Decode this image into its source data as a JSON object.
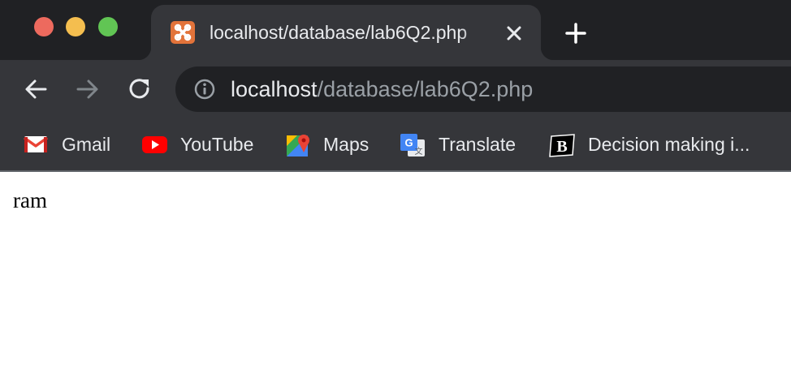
{
  "browser": {
    "tab": {
      "title": "localhost/database/lab6Q2.php",
      "favicon": "xampp-icon"
    },
    "address_bar": {
      "host": "localhost",
      "path": "/database/lab6Q2.php"
    },
    "bookmarks": [
      {
        "label": "Gmail",
        "icon": "gmail-icon"
      },
      {
        "label": "YouTube",
        "icon": "youtube-icon"
      },
      {
        "label": "Maps",
        "icon": "maps-icon"
      },
      {
        "label": "Translate",
        "icon": "translate-icon"
      },
      {
        "label": "Decision making i...",
        "icon": "b-logo-icon"
      }
    ],
    "colors": {
      "tabstrip": "#202124",
      "toolbar": "#35363a",
      "text": "#e8eaed",
      "muted": "#9aa0a6"
    }
  },
  "page": {
    "body_text": "ram"
  }
}
